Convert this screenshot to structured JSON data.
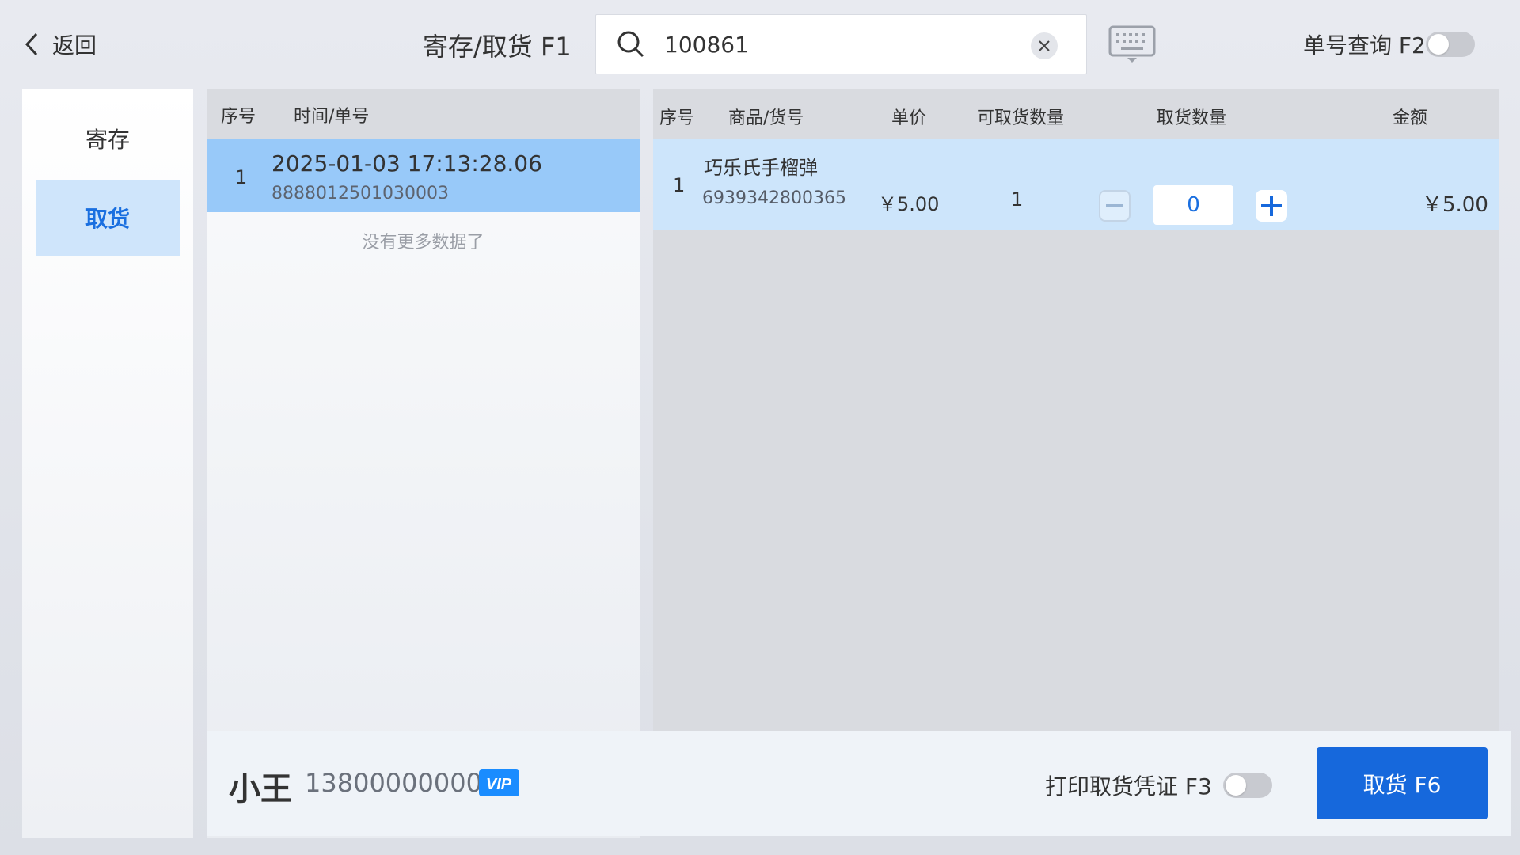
{
  "header": {
    "back_label": "返回",
    "page_title": "寄存/取货 F1",
    "search_value": "100861",
    "order_query_label": "单号查询 F2"
  },
  "sidebar": {
    "items": [
      {
        "label": "寄存"
      },
      {
        "label": "取货"
      }
    ]
  },
  "orders": {
    "columns": [
      "序号",
      "时间/单号"
    ],
    "rows": [
      {
        "index": "1",
        "time": "2025-01-03 17:13:28.06",
        "order_no": "8888012501030003"
      }
    ],
    "no_more_text": "没有更多数据了"
  },
  "items": {
    "columns": [
      "序号",
      "商品/货号",
      "单价",
      "可取货数量",
      "取货数量",
      "金额"
    ],
    "rows": [
      {
        "index": "1",
        "name": "巧乐氏手榴弹",
        "sku": "6939342800365",
        "price": "￥5.00",
        "available": "1",
        "quantity": "0",
        "amount": "￥5.00"
      }
    ]
  },
  "footer": {
    "customer_name": "小王",
    "customer_phone": "13800000000",
    "vip_label": "VIP",
    "print_label": "打印取货凭证 F3",
    "pickup_button": "取货 F6"
  },
  "colors": {
    "accent": "#1668dc",
    "selected_row": "#98c9f9",
    "item_row": "#cde5fb"
  }
}
